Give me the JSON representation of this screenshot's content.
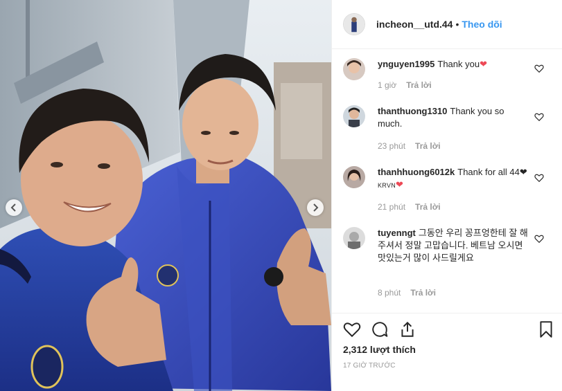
{
  "post": {
    "username": "incheon__utd.44",
    "follow_label": "Theo dõi",
    "likes": "2,312 lượt thích",
    "timestamp": "17 GIỜ TRƯỚC"
  },
  "comments": [
    {
      "user": "ynguyen1995",
      "text": "Thank you",
      "trail": "❤",
      "time": "1 giờ",
      "reply": "Trả lời"
    },
    {
      "user": "thanthuong1310",
      "text": "Thank you so much.",
      "time": "23 phút",
      "reply": "Trả lời"
    },
    {
      "user": "thanhhuong6012k",
      "text": "Thank for all 44",
      "mid": "❤",
      "krvn": "KRVN",
      "trail": "❤",
      "time": "21 phút",
      "reply": "Trả lời"
    },
    {
      "user": "tuyenngt",
      "text": "그동안 우리 꽁프엉한테 잘 해주셔서 정말 고맙습니다. 베트남 오시면 맛있는거 많이 사드릴게요",
      "time": "8 phút",
      "reply": "Trả lời"
    }
  ],
  "icons": {
    "prev": "chevron-left-icon",
    "next": "chevron-right-icon",
    "like": "heart-outline-icon",
    "comment": "speech-bubble-icon",
    "share": "share-upload-icon",
    "save": "bookmark-icon"
  },
  "colors": {
    "follow": "#3897f0",
    "heart": "#ed4956",
    "muted": "#999999"
  }
}
